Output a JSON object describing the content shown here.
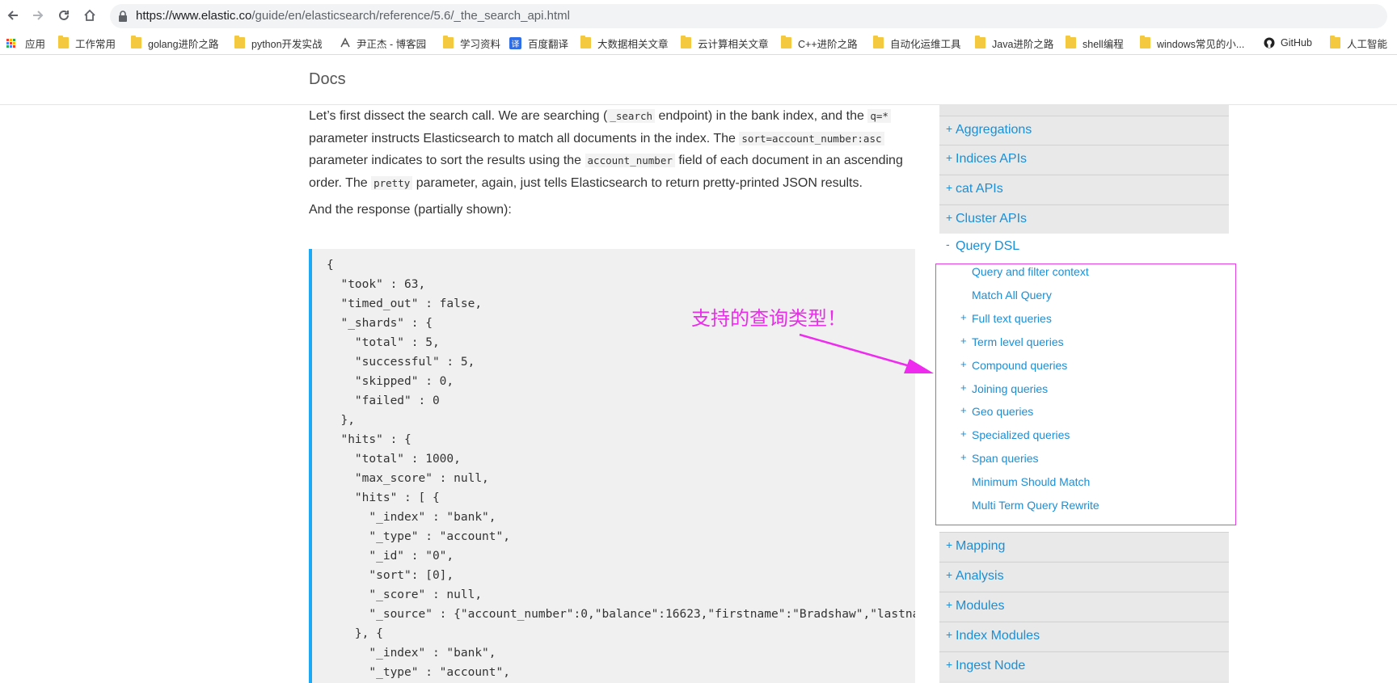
{
  "browser": {
    "url_main": "https://www.elastic.co",
    "url_path": "/guide/en/elasticsearch/reference/5.6/_the_search_api.html",
    "bookmarks": [
      {
        "label": "应用",
        "type": "apps"
      },
      {
        "label": "工作常用",
        "type": "folder"
      },
      {
        "label": "golang进阶之路",
        "type": "folder"
      },
      {
        "label": "python开发实战",
        "type": "folder"
      },
      {
        "label": "尹正杰 - 博客园",
        "type": "site"
      },
      {
        "label": "学习资料",
        "type": "folder"
      },
      {
        "label": "百度翻译",
        "type": "translate"
      },
      {
        "label": "大数据相关文章",
        "type": "folder"
      },
      {
        "label": "云计算相关文章",
        "type": "folder"
      },
      {
        "label": "C++进阶之路",
        "type": "folder"
      },
      {
        "label": "自动化运维工具",
        "type": "folder"
      },
      {
        "label": "Java进阶之路",
        "type": "folder"
      },
      {
        "label": "shell编程",
        "type": "folder"
      },
      {
        "label": "windows常见的小...",
        "type": "folder"
      },
      {
        "label": "GitHub",
        "type": "github"
      },
      {
        "label": "人工智能",
        "type": "folder"
      }
    ],
    "translate_glyph": "译"
  },
  "header": {
    "title": "Docs"
  },
  "content": {
    "p1": {
      "t1": "Let’s first dissect the search call. We are searching (",
      "c1": "_search",
      "t2": " endpoint) in the bank index, and the ",
      "c2": "q=*",
      "t3": " parameter instructs Elasticsearch to match all documents in the index. The ",
      "c3": "sort=account_number:asc",
      "t4": " parameter indicates to sort the results using the ",
      "c4": "account_number",
      "t5": " field of each document in an ascending order. The ",
      "c5": "pretty",
      "t6": " parameter, again, just tells Elasticsearch to return pretty-printed JSON results."
    },
    "p2": "And the response (partially shown):",
    "code": "{\n  \"took\" : 63,\n  \"timed_out\" : false,\n  \"_shards\" : {\n    \"total\" : 5,\n    \"successful\" : 5,\n    \"skipped\" : 0,\n    \"failed\" : 0\n  },\n  \"hits\" : {\n    \"total\" : 1000,\n    \"max_score\" : null,\n    \"hits\" : [ {\n      \"_index\" : \"bank\",\n      \"_type\" : \"account\",\n      \"_id\" : \"0\",\n      \"sort\": [0],\n      \"_score\" : null,\n      \"_source\" : {\"account_number\":0,\"balance\":16623,\"firstname\":\"Bradshaw\",\"lastname\":\"Mckenzie\"\n    }, {\n      \"_index\" : \"bank\",\n      \"_type\" : \"account\","
  },
  "sidebar": {
    "top_items": [
      {
        "pm": "+",
        "label": "Aggregations"
      },
      {
        "pm": "+",
        "label": "Indices APIs"
      },
      {
        "pm": "+",
        "label": "cat APIs"
      },
      {
        "pm": "+",
        "label": "Cluster APIs"
      }
    ],
    "open_item": {
      "pm": "-",
      "label": "Query DSL"
    },
    "sub_items": [
      {
        "pm": "",
        "label": "Query and filter context"
      },
      {
        "pm": "",
        "label": "Match All Query"
      },
      {
        "pm": "+",
        "label": "Full text queries"
      },
      {
        "pm": "+",
        "label": "Term level queries"
      },
      {
        "pm": "+",
        "label": "Compound queries"
      },
      {
        "pm": "+",
        "label": "Joining queries"
      },
      {
        "pm": "+",
        "label": "Geo queries"
      },
      {
        "pm": "+",
        "label": "Specialized queries"
      },
      {
        "pm": "+",
        "label": "Span queries"
      },
      {
        "pm": "",
        "label": "Minimum Should Match"
      },
      {
        "pm": "",
        "label": "Multi Term Query Rewrite"
      }
    ],
    "bottom_items": [
      {
        "pm": "+",
        "label": "Mapping"
      },
      {
        "pm": "+",
        "label": "Analysis"
      },
      {
        "pm": "+",
        "label": "Modules"
      },
      {
        "pm": "+",
        "label": "Index Modules"
      },
      {
        "pm": "+",
        "label": "Ingest Node"
      }
    ]
  },
  "annotation": {
    "text": "支持的查询类型！",
    "color": "#e82ee8"
  },
  "colors": {
    "link": "#1a8fd6",
    "code_border": "#1ba9f5"
  }
}
